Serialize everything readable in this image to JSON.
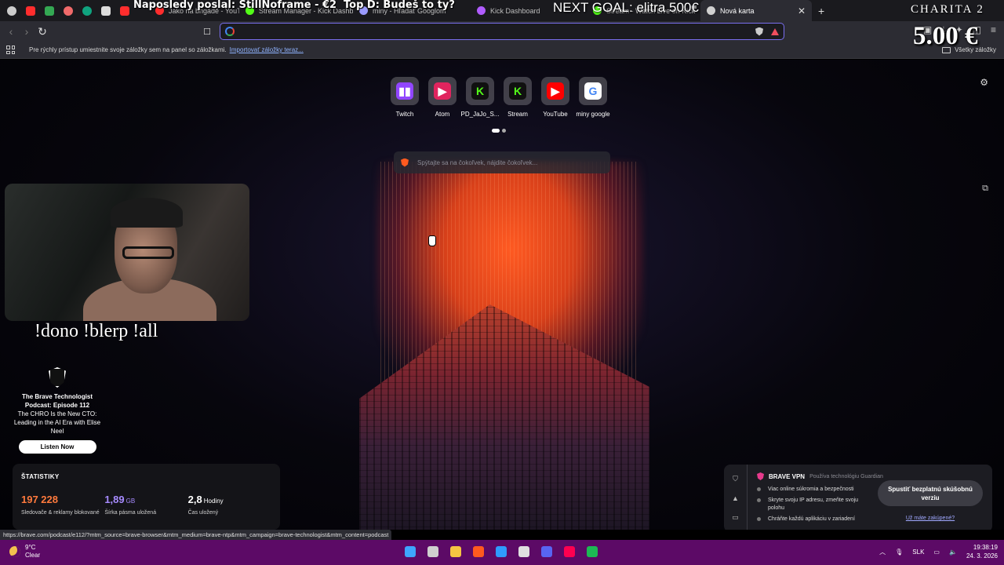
{
  "overlays": {
    "last_tip": "Naposledy poslal: StillNoframe - €2",
    "top_donor": "Top D: Budeš to ty?",
    "goal": "NEXT GOAL: elitra 500€",
    "charity_label": "CHARITA 2",
    "amount": "5.00 €",
    "commands": "!dono !blerp !all"
  },
  "tabs": [
    {
      "title": "Jako na brigádě - YouTube",
      "color": "#ff2d2d"
    },
    {
      "title": "Stream Manager - Kick Dashboard",
      "color": "#53fc18"
    },
    {
      "title": "miny - Hľadať Googlom",
      "color": "#9b9bff"
    },
    {
      "title": "Kick Dashboard",
      "color": "#b05cff"
    },
    {
      "title": "Stream - Watch Live on Kick",
      "color": "#53fc18"
    },
    {
      "title": "Nová karta",
      "color": "#d0d0d0",
      "active": true
    }
  ],
  "toolbar": {
    "omnibox_value": "",
    "omnibox_placeholder": ""
  },
  "bookmarks_bar": {
    "hint": "Pre rýchly prístup umiestnite svoje záložky sem na panel so záložkami.",
    "import_link": "Importovať záložky teraz...",
    "all_bookmarks": "Všetky záložky"
  },
  "top_sites": [
    {
      "label": "Twitch",
      "icon": "twitch-icon",
      "bg": "#9146ff",
      "glyph": "▮▮",
      "fg": "#fff"
    },
    {
      "label": "Atom",
      "icon": "atom-icon",
      "bg": "#e0245e",
      "glyph": "▶",
      "fg": "#fff"
    },
    {
      "label": "PD_JaJo_S...",
      "icon": "kick-icon",
      "bg": "#101010",
      "glyph": "K",
      "fg": "#53fc18"
    },
    {
      "label": "Stream",
      "icon": "kick-icon",
      "bg": "#101010",
      "glyph": "K",
      "fg": "#53fc18"
    },
    {
      "label": "YouTube",
      "icon": "youtube-icon",
      "bg": "#ff0000",
      "glyph": "▶",
      "fg": "#fff"
    },
    {
      "label": "miny google",
      "icon": "google-icon",
      "bg": "#ffffff",
      "glyph": "G",
      "fg": "#4285f4"
    }
  ],
  "search": {
    "placeholder": "Spýtajte sa na čokoľvek, nájdite čokoľvek..."
  },
  "podcast": {
    "title": "The Brave Technologist Podcast: Episode 112",
    "subtitle": "The CHRO Is the New CTO: Leading in the AI Era with Elise Neel",
    "button": "Listen Now"
  },
  "stats": {
    "heading": "ŠTATISTIKY",
    "items": [
      {
        "value": "197 228",
        "unit": "",
        "label": "Sledovače & reklamy blokované",
        "color": "#ff7a3d"
      },
      {
        "value": "1,89",
        "unit": "GB",
        "label": "Šírka pásma uložená",
        "color": "#a78bff"
      },
      {
        "value": "2,8",
        "unit": "Hodiny",
        "label": "Čas uložený",
        "color": "#ffffff"
      }
    ]
  },
  "vpn": {
    "title": "BRAVE VPN",
    "powered_by": "Používa technológiu Guardian",
    "features": [
      "Viac online súkromia a bezpečnosti",
      "Skryte svoju IP adresu, zmeňte svoju polohu",
      "Chráňte každú aplikáciu v zariadení"
    ],
    "cta": "Spustiť bezplatnú skúšobnú verziu",
    "already": "Už máte zakúpené?"
  },
  "status_url": "https://brave.com/podcast/e112/?mtm_source=brave-browser&mtm_medium=brave-ntp&mtm_campaign=brave-technologist&mtm_content=podcast",
  "taskbar": {
    "temp": "9°C",
    "condition": "Clear",
    "lang": "SLK",
    "time": "19:38:19",
    "date": "24. 3. 2026",
    "apps": [
      {
        "name": "start-icon",
        "color": "#3ea6ff"
      },
      {
        "name": "task-view-icon",
        "color": "#cfcfcf"
      },
      {
        "name": "file-explorer-icon",
        "color": "#f5c542"
      },
      {
        "name": "brave-icon",
        "color": "#ff5a1f"
      },
      {
        "name": "store-icon",
        "color": "#2f9bff"
      },
      {
        "name": "obs-icon",
        "color": "#e0e0e0"
      },
      {
        "name": "discord-icon",
        "color": "#5865f2"
      },
      {
        "name": "tiktok-icon",
        "color": "#ff0050"
      },
      {
        "name": "spotify-icon",
        "color": "#1db954"
      }
    ]
  }
}
